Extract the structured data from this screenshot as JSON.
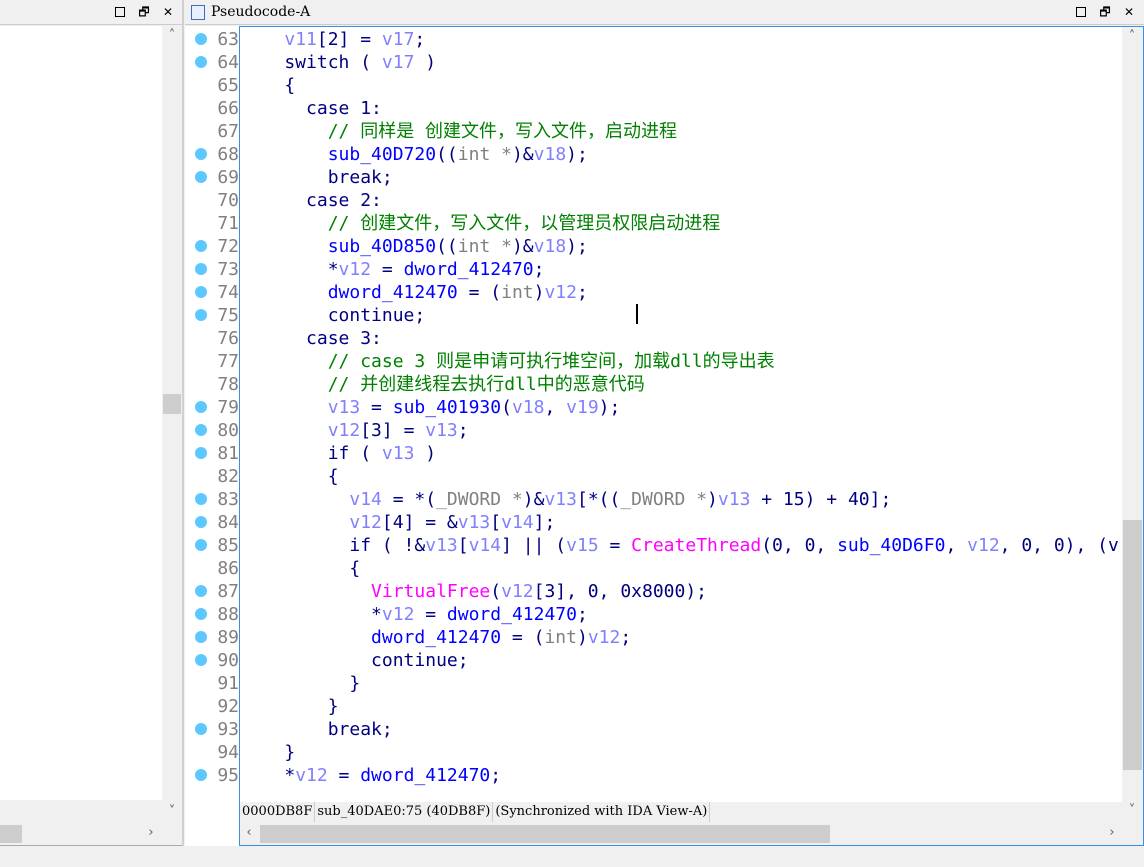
{
  "left_panel": {
    "buttons": [
      "maximize",
      "restore",
      "close"
    ]
  },
  "editor": {
    "title": "Pseudocode-A",
    "tab_icon": "pseudocode-icon",
    "lines": [
      {
        "num": "63",
        "bp": true,
        "text": "    v11[2] = v17;"
      },
      {
        "num": "64",
        "bp": true,
        "text": "    switch ( v17 )"
      },
      {
        "num": "65",
        "bp": false,
        "text": "    {"
      },
      {
        "num": "66",
        "bp": false,
        "text": "      case 1:"
      },
      {
        "num": "67",
        "bp": false,
        "text": "        // 同样是 创建文件，写入文件，启动进程"
      },
      {
        "num": "68",
        "bp": true,
        "text": "        sub_40D720((int *)&v18);"
      },
      {
        "num": "69",
        "bp": true,
        "text": "        break;"
      },
      {
        "num": "70",
        "bp": false,
        "text": "      case 2:"
      },
      {
        "num": "71",
        "bp": false,
        "text": "        // 创建文件，写入文件，以管理员权限启动进程"
      },
      {
        "num": "72",
        "bp": true,
        "text": "        sub_40D850((int *)&v18);"
      },
      {
        "num": "73",
        "bp": true,
        "text": "        *v12 = dword_412470;"
      },
      {
        "num": "74",
        "bp": true,
        "text": "        dword_412470 = (int)v12;"
      },
      {
        "num": "75",
        "bp": true,
        "text": "        continue;"
      },
      {
        "num": "76",
        "bp": false,
        "text": "      case 3:"
      },
      {
        "num": "77",
        "bp": false,
        "text": "        // case 3 则是申请可执行堆空间，加载dll的导出表"
      },
      {
        "num": "78",
        "bp": false,
        "text": "        // 并创建线程去执行dll中的恶意代码"
      },
      {
        "num": "79",
        "bp": true,
        "text": "        v13 = sub_401930(v18, v19);"
      },
      {
        "num": "80",
        "bp": true,
        "text": "        v12[3] = v13;"
      },
      {
        "num": "81",
        "bp": true,
        "text": "        if ( v13 )"
      },
      {
        "num": "82",
        "bp": false,
        "text": "        {"
      },
      {
        "num": "83",
        "bp": true,
        "text": "          v14 = *(_DWORD *)&v13[*((_DWORD *)v13 + 15) + 40];"
      },
      {
        "num": "84",
        "bp": true,
        "text": "          v12[4] = &v13[v14];"
      },
      {
        "num": "85",
        "bp": true,
        "text": "          if ( !&v13[v14] || (v15 = CreateThread(0, 0, sub_40D6F0, v12, 0, 0), (v"
      },
      {
        "num": "86",
        "bp": false,
        "text": "          {"
      },
      {
        "num": "87",
        "bp": true,
        "text": "            VirtualFree(v12[3], 0, 0x8000);"
      },
      {
        "num": "88",
        "bp": true,
        "text": "            *v12 = dword_412470;"
      },
      {
        "num": "89",
        "bp": true,
        "text": "            dword_412470 = (int)v12;"
      },
      {
        "num": "90",
        "bp": true,
        "text": "            continue;"
      },
      {
        "num": "91",
        "bp": false,
        "text": "          }"
      },
      {
        "num": "92",
        "bp": false,
        "text": "        }"
      },
      {
        "num": "93",
        "bp": true,
        "text": "        break;"
      },
      {
        "num": "94",
        "bp": false,
        "text": "    }"
      },
      {
        "num": "95",
        "bp": true,
        "text": "    *v12 = dword_412470;"
      }
    ]
  },
  "status": {
    "address": "0000DB8F",
    "location": "sub_40DAE0:75 (40DB8F)",
    "sync": "(Synchronized with IDA View-A)"
  },
  "colors": {
    "keyword": "#000080",
    "variable": "#8080ff",
    "function": "#0000ff",
    "comment": "#008000",
    "api": "#ff00ff",
    "type": "#808080",
    "breakpoint": "#5cc8ff"
  }
}
